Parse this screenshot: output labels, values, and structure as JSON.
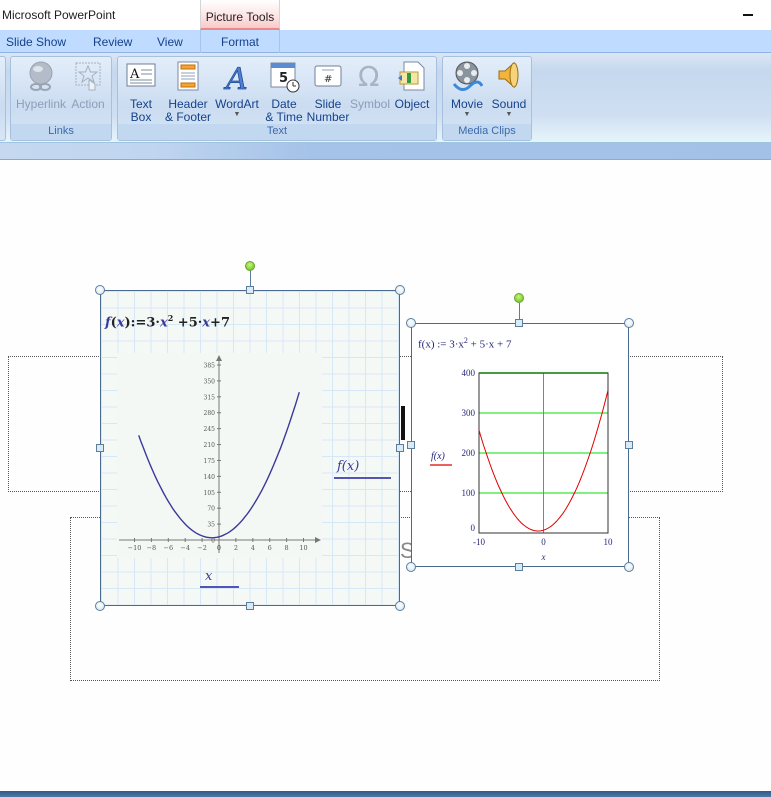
{
  "window": {
    "app_title": "Microsoft PowerPoint",
    "context_tab": "Picture Tools"
  },
  "tabs": [
    {
      "label": "Slide Show"
    },
    {
      "label": "Review"
    },
    {
      "label": "View"
    },
    {
      "label": "Format"
    }
  ],
  "ribbon": {
    "groups": [
      {
        "label": "Links",
        "buttons": [
          {
            "label": "Hyperlink",
            "icon": "globe-link-icon",
            "disabled": true
          },
          {
            "label": "Action",
            "icon": "star-cursor-icon",
            "disabled": true
          }
        ]
      },
      {
        "label": "Text",
        "buttons": [
          {
            "label_line1": "Text",
            "label_line2": "Box",
            "icon": "text-box-icon"
          },
          {
            "label_line1": "Header",
            "label_line2": "& Footer",
            "icon": "header-footer-icon"
          },
          {
            "label_line1": "WordArt",
            "dropdown": true,
            "icon": "wordart-icon"
          },
          {
            "label_line1": "Date",
            "label_line2": "& Time",
            "icon": "calendar-clock-icon"
          },
          {
            "label_line1": "Slide",
            "label_line2": "Number",
            "icon": "slide-number-icon"
          },
          {
            "label_line1": "Symbol",
            "icon": "omega-icon",
            "disabled": true
          },
          {
            "label_line1": "Object",
            "icon": "object-icon"
          }
        ]
      },
      {
        "label": "Media Clips",
        "buttons": [
          {
            "label": "Movie",
            "dropdown": true,
            "icon": "film-reel-icon"
          },
          {
            "label": "Sound",
            "dropdown": true,
            "icon": "speaker-icon"
          }
        ]
      }
    ]
  },
  "slide": {
    "ghost_text": "S",
    "left_object": {
      "formula": {
        "f": "f",
        "x": "x",
        "rest1": "):=3·",
        "x2": "x",
        "sup": "2",
        "rest2": " +5·",
        "x3": "x",
        "rest3": "+7",
        "open": "("
      },
      "y_label": "f(x)",
      "x_label": "x",
      "y_ticks": [
        "385",
        "350",
        "315",
        "280",
        "245",
        "210",
        "175",
        "140",
        "105",
        "70",
        "35",
        "0"
      ],
      "x_ticks": [
        "−10",
        "−8",
        "−6",
        "−4",
        "−2",
        "0",
        "2",
        "4",
        "6",
        "8",
        "10"
      ]
    },
    "right_object": {
      "formula": "f(x) := 3·x",
      "formula_sup": "2",
      "formula_rest": " + 5·x + 7",
      "y_label": "f(x)",
      "x_label": "x",
      "y_ticks": [
        "400",
        "300",
        "200",
        "100",
        "0"
      ],
      "x_ticks": [
        "-10",
        "0",
        "10"
      ],
      "curve_color": "#e00000",
      "grid_color": "#00e000"
    }
  },
  "chart_data": [
    {
      "type": "line",
      "title": "f(x):=3·x^2+5·x+7",
      "xlabel": "x",
      "ylabel": "f(x)",
      "xlim": [
        -11,
        11
      ],
      "ylim": [
        0,
        385
      ],
      "series": [
        {
          "name": "f(x)",
          "color": "#3a3a9a",
          "x": [
            -9.5,
            -8,
            -6,
            -4,
            -2,
            -0.83,
            0,
            2,
            4,
            6,
            8,
            9.5
          ],
          "y": [
            260.25,
            159,
            85,
            35,
            9,
            4.92,
            7,
            29,
            75,
            145,
            239,
            325.25
          ]
        }
      ],
      "grid": false
    },
    {
      "type": "line",
      "title": "f(x) := 3·x^2 + 5·x + 7",
      "xlabel": "x",
      "ylabel": "f(x)",
      "xlim": [
        -10,
        10
      ],
      "ylim": [
        0,
        400
      ],
      "series": [
        {
          "name": "f(x)",
          "color": "#e00000",
          "x": [
            -10,
            -8,
            -6,
            -4,
            -2,
            -0.83,
            0,
            2,
            4,
            6,
            8,
            10
          ],
          "y": [
            257,
            159,
            85,
            35,
            9,
            4.92,
            7,
            29,
            75,
            145,
            239,
            357
          ]
        }
      ],
      "grid": true
    }
  ]
}
